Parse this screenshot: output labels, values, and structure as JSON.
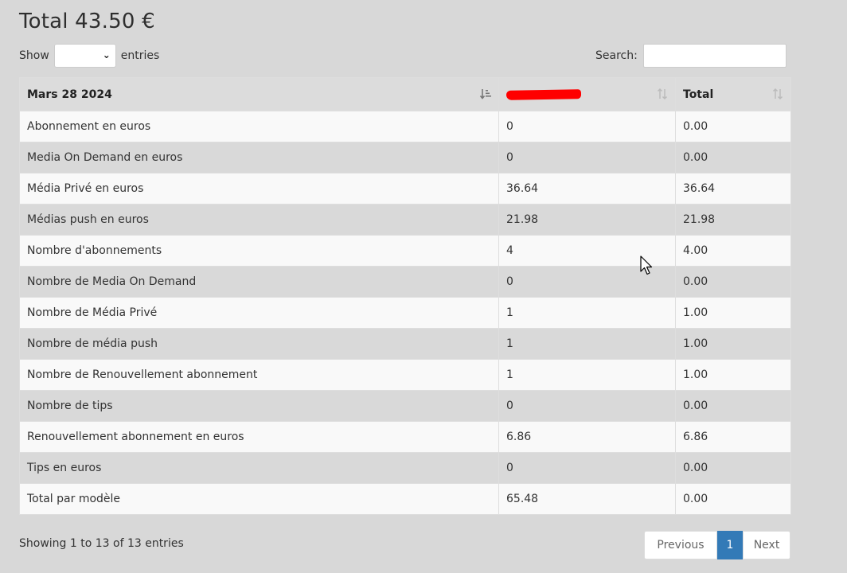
{
  "header": {
    "title": "Total 43.50 €"
  },
  "length_control": {
    "show_label": "Show",
    "entries_label": "entries",
    "selected_value": ""
  },
  "search": {
    "label": "Search:",
    "value": ""
  },
  "table": {
    "columns": [
      {
        "label": "Mars 28 2024",
        "sort": "ascending"
      },
      {
        "label": "",
        "sort": "none",
        "redacted": true
      },
      {
        "label": "Total",
        "sort": "none"
      }
    ],
    "rows": [
      [
        "Abonnement en euros",
        "0",
        "0.00"
      ],
      [
        "Media On Demand en euros",
        "0",
        "0.00"
      ],
      [
        "Média Privé en euros",
        "36.64",
        "36.64"
      ],
      [
        "Médias push en euros",
        "21.98",
        "21.98"
      ],
      [
        "Nombre d'abonnements",
        "4",
        "4.00"
      ],
      [
        "Nombre de Media On Demand",
        "0",
        "0.00"
      ],
      [
        "Nombre de Média Privé",
        "1",
        "1.00"
      ],
      [
        "Nombre de média push",
        "1",
        "1.00"
      ],
      [
        "Nombre de Renouvellement abonnement",
        "1",
        "1.00"
      ],
      [
        "Nombre de tips",
        "0",
        "0.00"
      ],
      [
        "Renouvellement abonnement en euros",
        "6.86",
        "6.86"
      ],
      [
        "Tips en euros",
        "0",
        "0.00"
      ],
      [
        "Total par modèle",
        "65.48",
        "0.00"
      ]
    ]
  },
  "footer": {
    "info": "Showing 1 to 13 of 13 entries",
    "pagination": {
      "previous": "Previous",
      "current_page": "1",
      "next": "Next"
    }
  },
  "colors": {
    "background": "#d8d8d8",
    "header_bg": "#dcdcdc",
    "odd_row": "#f9f9f9",
    "even_row": "#d9d9d9",
    "active_page": "#337ab7",
    "redaction": "#ff0000"
  }
}
